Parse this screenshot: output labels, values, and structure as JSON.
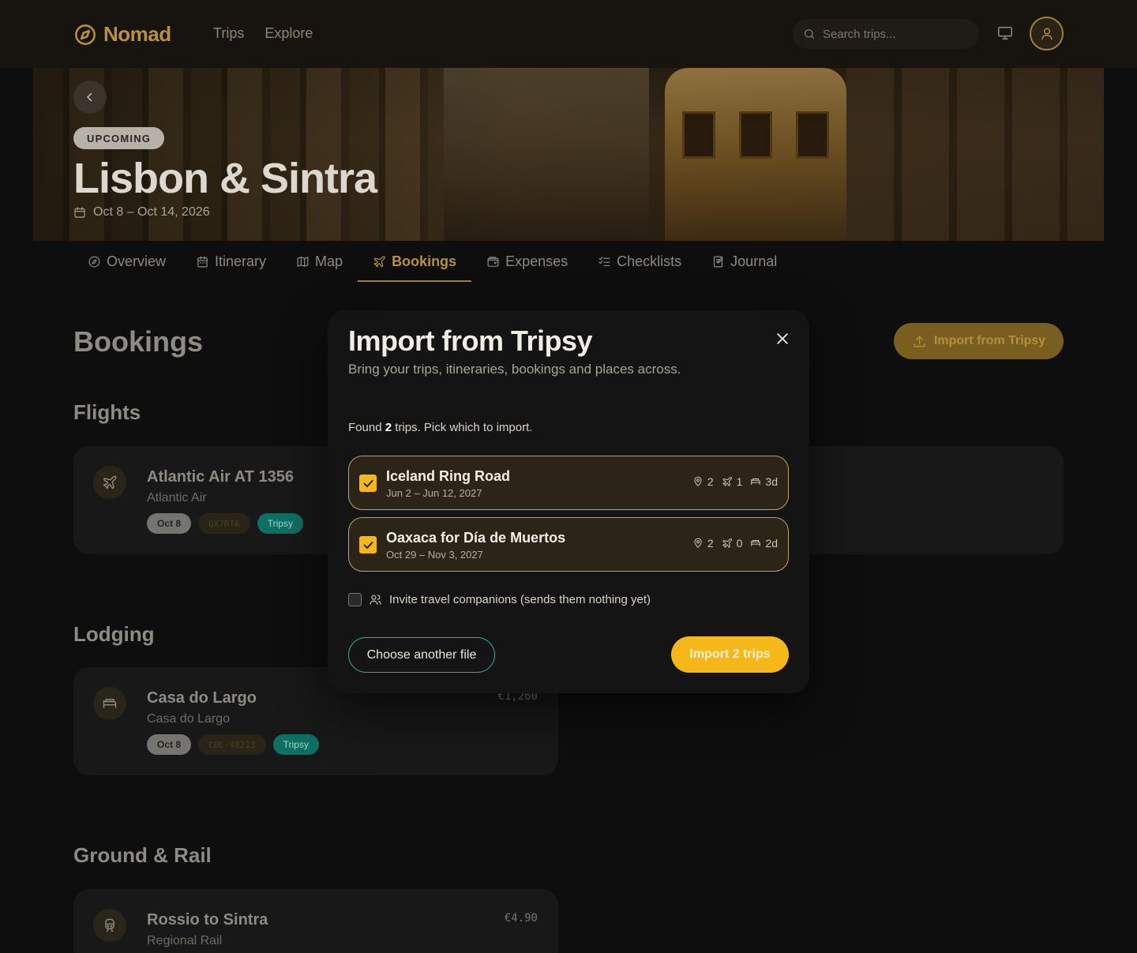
{
  "app": {
    "logo_text": "Nomad",
    "nav": [
      "Trips",
      "Explore"
    ],
    "search_placeholder": "Search trips...",
    "accent_color": "#b9903d"
  },
  "trip": {
    "status": "UPCOMING",
    "title": "Lisbon & Sintra",
    "dates": "Oct 8 – Oct 14, 2026"
  },
  "tabs": [
    {
      "label": "Overview",
      "icon": "compass-icon"
    },
    {
      "label": "Itinerary",
      "icon": "calendar-icon"
    },
    {
      "label": "Map",
      "icon": "map-icon"
    },
    {
      "label": "Bookings",
      "icon": "plane-icon",
      "active": true
    },
    {
      "label": "Expenses",
      "icon": "wallet-icon"
    },
    {
      "label": "Checklists",
      "icon": "checklist-icon"
    },
    {
      "label": "Journal",
      "icon": "journal-icon"
    }
  ],
  "bookings": {
    "title": "Bookings",
    "import_button": "Import from Tripsy",
    "sections": {
      "flights": "Flights",
      "lodging": "Lodging",
      "ground": "Ground & Rail"
    },
    "flight": {
      "title": "Atlantic Air AT 1356",
      "subtitle": "Atlantic Air",
      "date": "Oct 8",
      "ref": "QX7RTA",
      "source": "Tripsy"
    },
    "lodging": {
      "title": "Casa do Largo",
      "subtitle": "Casa do Largo",
      "date": "Oct 8",
      "ref": "CDL-48213",
      "source": "Tripsy",
      "price": "€1,260"
    },
    "ground": {
      "title": "Rossio to Sintra",
      "subtitle": "Regional Rail",
      "price": "€4.90"
    }
  },
  "modal": {
    "title": "Import from Tripsy",
    "subtitle": "Bring your trips, itineraries, bookings and places across.",
    "found_prefix": "Found ",
    "found_count": "2",
    "found_suffix": " trips. Pick which to import.",
    "trips": [
      {
        "name": "Iceland Ring Road",
        "dates": "Jun 2 – Jun 12, 2027",
        "places": "2",
        "flights": "1",
        "stays": "3d",
        "checked": true
      },
      {
        "name": "Oaxaca for Día de Muertos",
        "dates": "Oct 29 – Nov 3, 2027",
        "places": "2",
        "flights": "0",
        "stays": "2d",
        "checked": true
      }
    ],
    "invite_label": "Invite travel companions (sends them nothing yet)",
    "choose_button": "Choose another file",
    "confirm_button": "Import 2 trips"
  }
}
